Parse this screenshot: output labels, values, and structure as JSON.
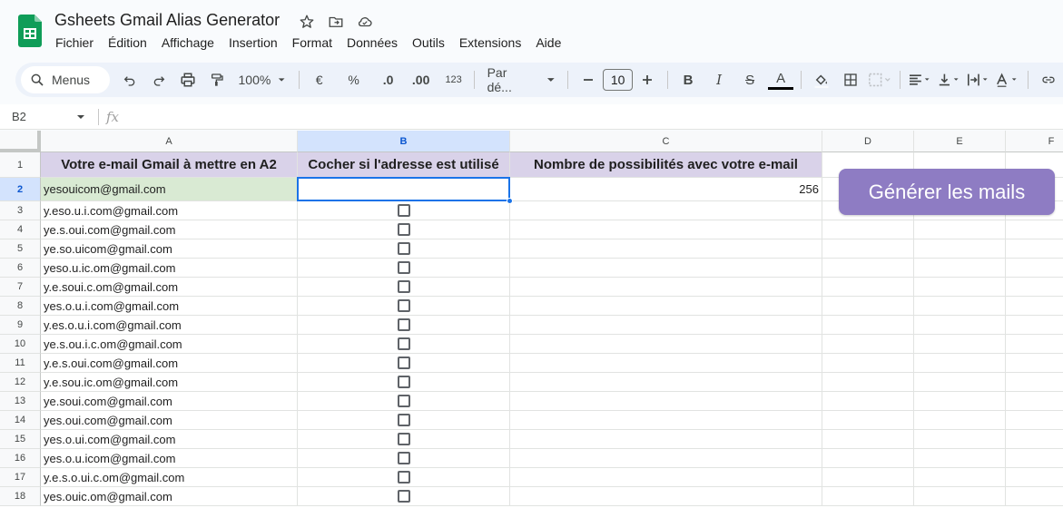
{
  "app": {
    "title": "Gsheets Gmail Alias Generator",
    "brand_color": "#0f9d58"
  },
  "menus": [
    "Fichier",
    "Édition",
    "Affichage",
    "Insertion",
    "Format",
    "Données",
    "Outils",
    "Extensions",
    "Aide"
  ],
  "toolbar": {
    "search_label": "Menus",
    "zoom": "100%",
    "currency": "€",
    "percent": "%",
    "dec_decrease": ".0",
    "dec_increase": ".00",
    "number_format": "123",
    "font": "Par dé...",
    "font_size": "10",
    "bold": "B",
    "italic": "I",
    "strike": "S",
    "text_color": "A"
  },
  "formula_bar": {
    "cell_ref": "B2",
    "fx": "fx",
    "value": ""
  },
  "columns": [
    "A",
    "B",
    "C",
    "D",
    "E",
    "F"
  ],
  "header_row": {
    "a": "Votre e-mail Gmail à mettre en A2",
    "b": "Cocher si l'adresse est utilisé",
    "c": "Nombre de possibilités avec votre e-mail"
  },
  "row2": {
    "email": "yesouicom@gmail.com",
    "count": "256"
  },
  "rows": [
    {
      "num": "1"
    },
    {
      "num": "2"
    },
    {
      "num": "3",
      "email": "y.eso.u.i.com@gmail.com"
    },
    {
      "num": "4",
      "email": "ye.s.oui.com@gmail.com"
    },
    {
      "num": "5",
      "email": "ye.so.uicom@gmail.com"
    },
    {
      "num": "6",
      "email": "yeso.u.ic.om@gmail.com"
    },
    {
      "num": "7",
      "email": "y.e.soui.c.om@gmail.com"
    },
    {
      "num": "8",
      "email": "yes.o.u.i.com@gmail.com"
    },
    {
      "num": "9",
      "email": "y.es.o.u.i.com@gmail.com"
    },
    {
      "num": "10",
      "email": "ye.s.ou.i.c.om@gmail.com"
    },
    {
      "num": "11",
      "email": "y.e.s.oui.com@gmail.com"
    },
    {
      "num": "12",
      "email": "y.e.sou.ic.om@gmail.com"
    },
    {
      "num": "13",
      "email": "ye.soui.com@gmail.com"
    },
    {
      "num": "14",
      "email": "yes.oui.com@gmail.com"
    },
    {
      "num": "15",
      "email": "yes.o.ui.com@gmail.com"
    },
    {
      "num": "16",
      "email": "yes.o.u.icom@gmail.com"
    },
    {
      "num": "17",
      "email": "y.e.s.o.ui.c.om@gmail.com"
    },
    {
      "num": "18",
      "email": "yes.ouic.om@gmail.com"
    }
  ],
  "generate_button": {
    "label": "Générer les mails",
    "color": "#8e7cc3"
  },
  "selected_cell": "B2"
}
